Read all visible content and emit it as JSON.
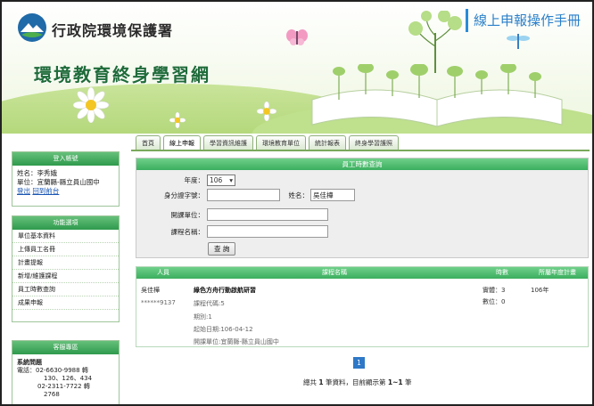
{
  "header": {
    "org_name": "行政院環境保護署",
    "site_title": "環境教育終身學習網",
    "manual_link": "線上申報操作手冊"
  },
  "tabs": [
    {
      "label": "首頁",
      "active": false
    },
    {
      "label": "線上申報",
      "active": true
    },
    {
      "label": "學習資訊維護",
      "active": false
    },
    {
      "label": "環境教育單位",
      "active": false
    },
    {
      "label": "統計報表",
      "active": false
    },
    {
      "label": "終身學習護照",
      "active": false
    }
  ],
  "login": {
    "title": "登入帳號",
    "name_line": "姓名：李秀娥",
    "unit_line": "單位：宜蘭縣-縣立員山國中",
    "logout": "登出",
    "back": "回到前台"
  },
  "menu": {
    "title": "功能選項",
    "items": [
      "單位基本資料",
      "上傳員工名冊",
      "計畫提報",
      "新增/維護課程",
      "員工時數查詢",
      "成果申報"
    ]
  },
  "service": {
    "title": "客服專區",
    "heading": "系統問題",
    "lines": [
      "電話：02-6630-9988 轉",
      "130、126、434",
      "02-2311-7722 轉",
      "2768"
    ]
  },
  "query": {
    "title": "員工時數查詢",
    "year_label": "年度：",
    "year_value": "106",
    "id_label": "身分證字號：",
    "id_value": "",
    "name_label": "姓名：",
    "name_value": "吳佳樺",
    "unit_label": "開課單位：",
    "unit_value": "",
    "course_label": "課程名稱：",
    "course_value": "",
    "search_button": "查 詢"
  },
  "results": {
    "headers": {
      "person": "人員",
      "course": "課程名稱",
      "hours": "時數",
      "plan": "所屬年度計畫"
    },
    "row": {
      "person_name": "吳佳樺",
      "person_id": "******9137",
      "course_name": "綠色方舟行動啟航研習",
      "course_code": "課程代碼:5",
      "period": "期別:1",
      "start_date": "起始日期:106-04-12",
      "host_unit": "開課單位:宜蘭縣-縣立員山國中",
      "hours_physical": "實體：3",
      "hours_digital": "數位：0",
      "plan_year": "106年"
    },
    "page": "1",
    "summary_pre": "總共",
    "summary_count": "1",
    "summary_mid": "筆資料，目前顯示第",
    "summary_range": "1~1",
    "summary_post": "筆"
  }
}
